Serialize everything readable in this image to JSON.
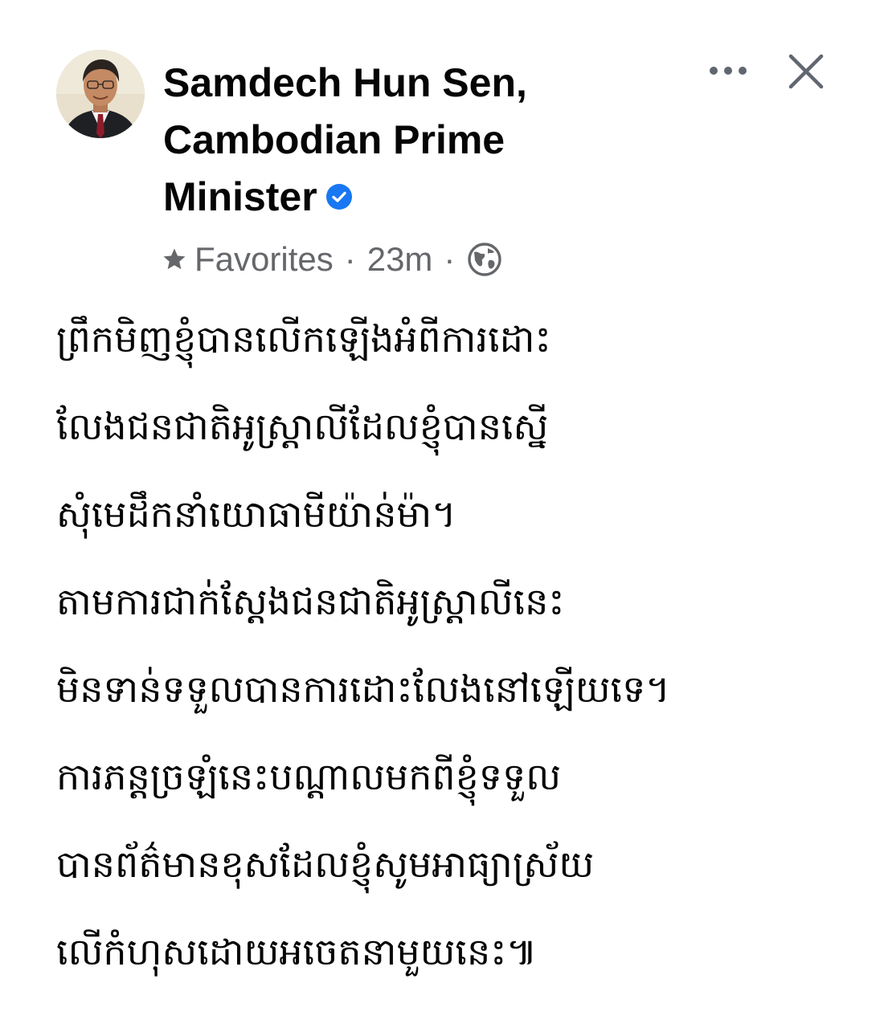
{
  "post": {
    "author": {
      "name": "Samdech Hun Sen, Cambodian Prime Minister",
      "verified": true,
      "avatar_icon": "profile-photo"
    },
    "meta": {
      "audience": "Favorites",
      "separator": "·",
      "time": "23m",
      "privacy_icon": "globe-icon"
    },
    "actions": {
      "more_icon": "more-horizontal-icon",
      "close_icon": "close-icon"
    },
    "body_lines": [
      "ព្រឹកមិញខ្ញុំបានលើកឡើងអំពីការដោះ",
      "លែងជនជាតិអូស្ត្រាលីដែលខ្ញុំបានស្នើ",
      "សុំមេដឹកនាំយោធាមីយ៉ាន់ម៉ា។",
      "តាមការជាក់ស្តែងជនជាតិអូស្ត្រាលីនេះ",
      "មិនទាន់ទទួលបានការដោះលែងនៅឡើយទេ។",
      "ការភន្តច្រឡំនេះបណ្តាលមកពីខ្ញុំទទួល",
      "បានព័ត៌មានខុសដែលខ្ញុំសូមអាធ្យាស្រ័យ",
      "លើកំហុសដោយអចេតនាមួយនេះ៕"
    ]
  },
  "colors": {
    "text_primary": "#050505",
    "text_secondary": "#65676b",
    "verified_blue": "#1877f2",
    "icon_gray": "#606770"
  }
}
